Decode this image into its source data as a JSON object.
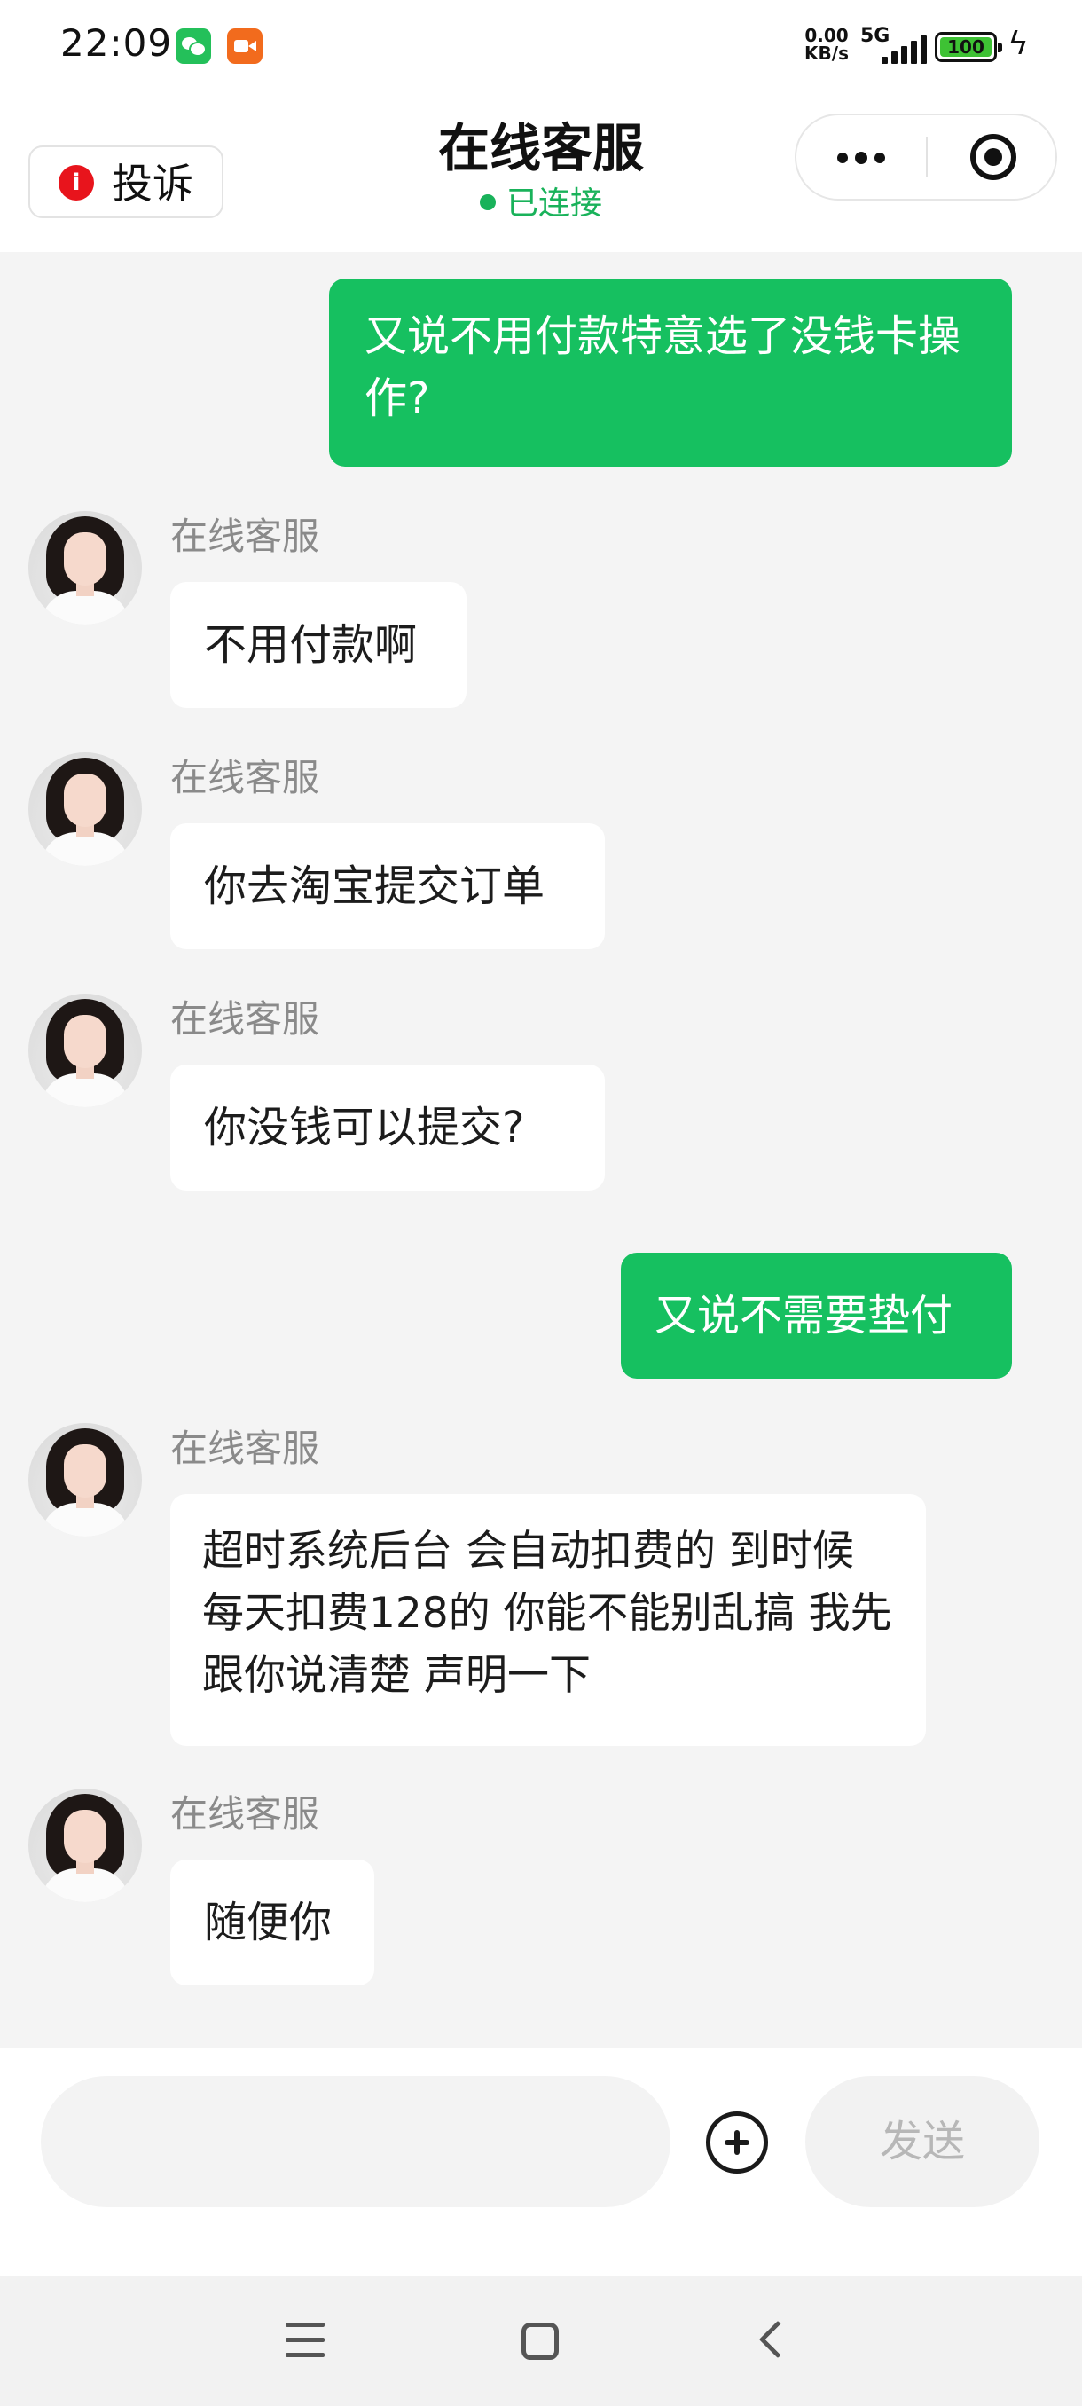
{
  "status_bar": {
    "time": "22:09",
    "net_speed_value": "0.00",
    "net_speed_unit": "KB/s",
    "network_type": "5G",
    "battery_level": "100",
    "apps": [
      "wechat-icon",
      "video-recorder-icon"
    ]
  },
  "header": {
    "complaint_label": "投诉",
    "title": "在线客服",
    "connection_status": "已连接"
  },
  "messages": [
    {
      "from": "user",
      "text": "又说不用付款特意选了没钱卡操作?"
    },
    {
      "from": "agent",
      "sender": "在线客服",
      "text": "不用付款啊"
    },
    {
      "from": "agent",
      "sender": "在线客服",
      "text": "你去淘宝提交订单"
    },
    {
      "from": "agent",
      "sender": "在线客服",
      "text": "你没钱可以提交?"
    },
    {
      "from": "user",
      "text": "又说不需要垫付"
    },
    {
      "from": "agent",
      "sender": "在线客服",
      "text": "超时系统后台 会自动扣费的 到时候每天扣费128的 你能不能别乱搞 我先跟你说清楚 声明一下"
    },
    {
      "from": "agent",
      "sender": "在线客服",
      "text": "随便你"
    }
  ],
  "input": {
    "value": "",
    "send_label": "发送"
  },
  "colors": {
    "accent_green": "#16c060",
    "status_green": "#19b25a",
    "complaint_red": "#e8141c"
  }
}
